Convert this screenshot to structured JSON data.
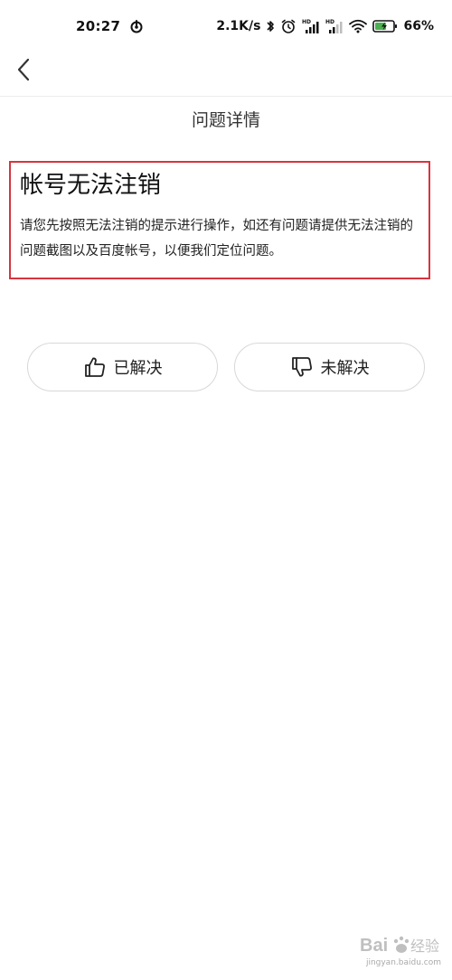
{
  "status_bar": {
    "time": "20:27",
    "network_speed": "2.1K/s",
    "battery_percent": "66",
    "battery_unit": "%",
    "icons": [
      "sync-icon",
      "bluetooth-icon",
      "alarm-icon",
      "signal-hd-icon",
      "signal-hd-icon",
      "wifi-icon",
      "battery-charging-icon"
    ]
  },
  "header": {
    "back_icon": "chevron-left-icon"
  },
  "page": {
    "title": "问题详情"
  },
  "question": {
    "title": "帐号无法注销",
    "body": "请您先按照无法注销的提示进行操作，如还有问题请提供无法注销的问题截图以及百度帐号，以便我们定位问题。"
  },
  "feedback": {
    "resolved_label": "已解决",
    "resolved_icon": "thumbs-up-icon",
    "unresolved_label": "未解决",
    "unresolved_icon": "thumbs-down-icon"
  },
  "watermark": {
    "brand": "Bai 经验",
    "url": "jingyan.baidu.com"
  },
  "colors": {
    "highlight_border": "#d6353f",
    "button_border": "#d8d8d8",
    "text": "#222222"
  }
}
